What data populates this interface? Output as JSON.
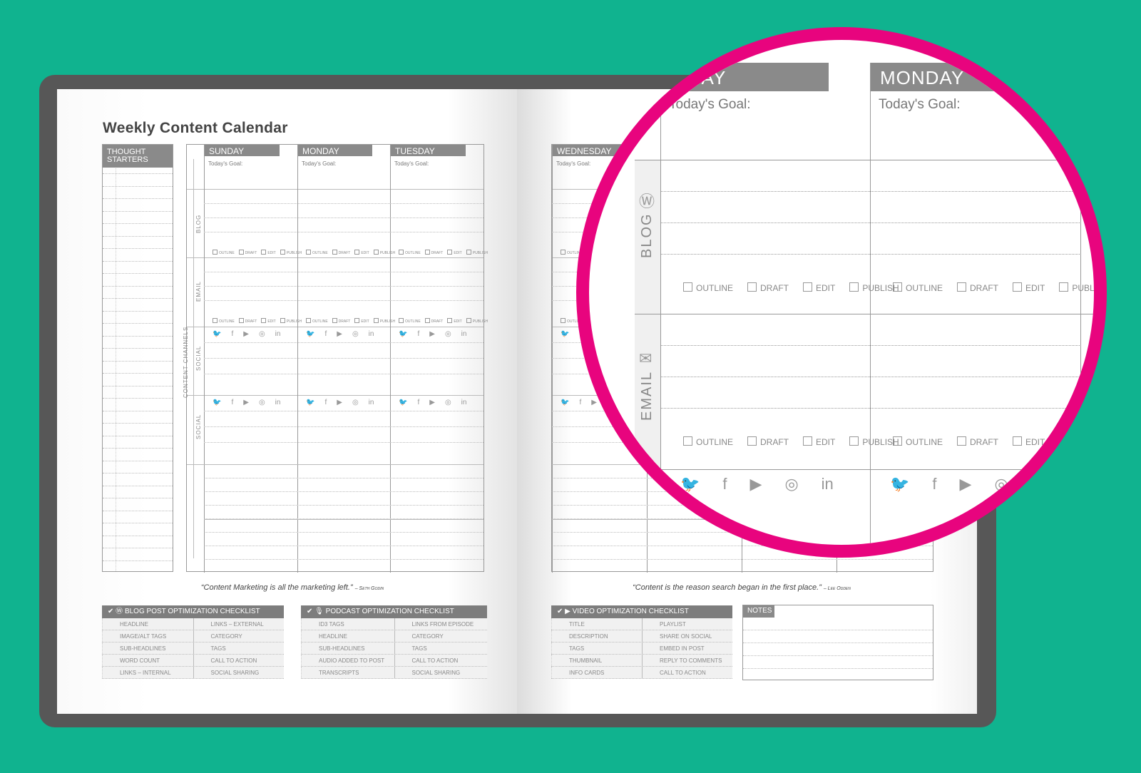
{
  "colors": {
    "background": "#10b38f",
    "accent": "#e8047e",
    "header": "#8a8a8a"
  },
  "title": "Weekly Content Calendar",
  "thought_starters": "THOUGHT STARTERS",
  "content_channels": "CONTENT CHANNELS",
  "left_days": [
    "SUNDAY",
    "MONDAY",
    "TUESDAY"
  ],
  "right_days": [
    "WEDNESDAY"
  ],
  "goal_label": "Today's Goal:",
  "channels": [
    "BLOG",
    "EMAIL",
    "SOCIAL",
    "SOCIAL"
  ],
  "channel_icons": [
    "wordpress-icon",
    "envelope-icon"
  ],
  "task_checks": [
    "OUTLINE",
    "DRAFT",
    "EDIT",
    "PUBLISH"
  ],
  "social_icons": [
    "twitter-icon",
    "facebook-icon",
    "youtube-icon",
    "instagram-icon",
    "linkedin-icon"
  ],
  "social_glyphs": [
    "🐦",
    "f",
    "▶",
    "◎",
    "in"
  ],
  "quotes": [
    {
      "text": "“Content Marketing  is all the marketing left.”",
      "author": "– Seth Godin"
    },
    {
      "text": "“Content is the reason search began in the first place.”",
      "author": "– Lee Odden"
    }
  ],
  "checklists": [
    {
      "title": "BLOG POST OPTIMIZATION CHECKLIST",
      "icon": "wordpress-icon",
      "rows": [
        [
          "HEADLINE",
          "LINKS – EXTERNAL"
        ],
        [
          "IMAGE/ALT TAGS",
          "CATEGORY"
        ],
        [
          "SUB-HEADLINES",
          "TAGS"
        ],
        [
          "WORD COUNT",
          "CALL TO ACTION"
        ],
        [
          "LINKS – INTERNAL",
          "SOCIAL SHARING"
        ]
      ]
    },
    {
      "title": "PODCAST OPTIMIZATION CHECKLIST",
      "icon": "microphone-icon",
      "rows": [
        [
          "ID3 TAGS",
          "LINKS FROM EPISODE"
        ],
        [
          "HEADLINE",
          "CATEGORY"
        ],
        [
          "SUB-HEADLINES",
          "TAGS"
        ],
        [
          "AUDIO ADDED TO POST",
          "CALL TO ACTION"
        ],
        [
          "TRANSCRIPTS",
          "SOCIAL SHARING"
        ]
      ]
    },
    {
      "title": "VIDEO OPTIMIZATION CHECKLIST",
      "icon": "youtube-icon",
      "rows": [
        [
          "TITLE",
          "PLAYLIST"
        ],
        [
          "DESCRIPTION",
          "SHARE ON SOCIAL"
        ],
        [
          "TAGS",
          "EMBED IN POST"
        ],
        [
          "THUMBNAIL",
          "REPLY TO COMMENTS"
        ],
        [
          "INFO CARDS",
          "CALL TO ACTION"
        ]
      ]
    }
  ],
  "notes": "NOTES",
  "magnifier": {
    "days": [
      "SUNDAY",
      "MONDAY"
    ],
    "visible_partial": "NDAY",
    "goal_label": "Today's Goal:",
    "channels": [
      "BLOG",
      "EMAIL"
    ]
  }
}
